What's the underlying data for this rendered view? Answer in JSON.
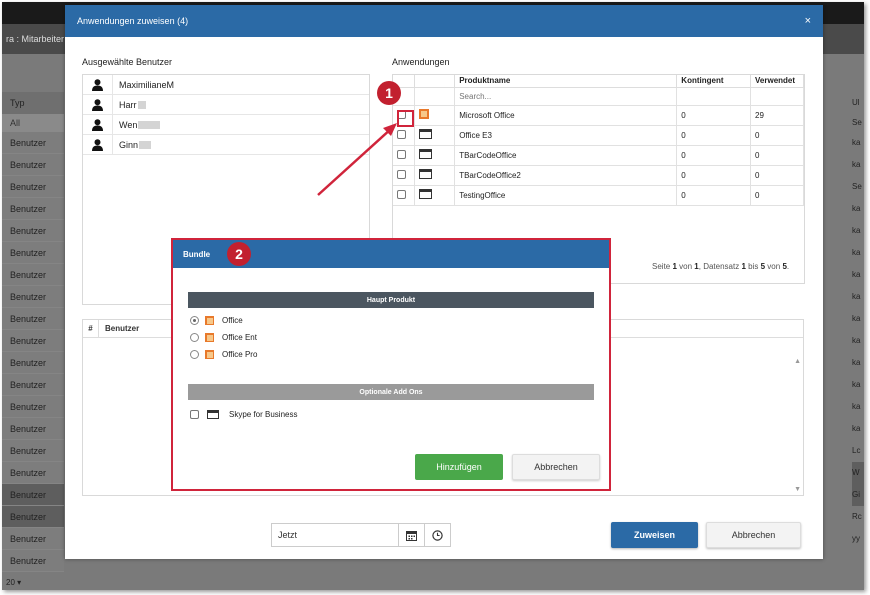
{
  "background": {
    "breadcrumb": "ra : Mitarbeiter (",
    "type_header": "Typ",
    "type_filter": "All",
    "rows": [
      "Benutzer",
      "Benutzer",
      "Benutzer",
      "Benutzer",
      "Benutzer",
      "Benutzer",
      "Benutzer",
      "Benutzer",
      "Benutzer",
      "Benutzer",
      "Benutzer",
      "Benutzer",
      "Benutzer",
      "Benutzer",
      "Benutzer",
      "Benutzer",
      "Benutzer",
      "Benutzer",
      "Benutzer",
      "Benutzer"
    ],
    "right_header": "Ul",
    "right_filter": "Se",
    "right_cells": [
      "ka",
      "ka",
      "Se",
      "ka",
      "ka",
      "ka",
      "ka",
      "ka",
      "ka",
      "ka",
      "ka",
      "ka",
      "ka",
      "ka",
      "Lc",
      "W",
      "Gi",
      "Rc",
      "yy"
    ],
    "page_size": "20"
  },
  "modal": {
    "title": "Anwendungen zuweisen (4)",
    "close": "×",
    "selected_users_title": "Ausgewählte Benutzer",
    "users": [
      "MaximilianeM",
      "Harr",
      "Wen",
      "Ginn"
    ],
    "applications_title": "Anwendungen",
    "apps_columns": {
      "name": "Produktname",
      "quota": "Kontingent",
      "used": "Verwendet"
    },
    "search_placeholder": "Search...",
    "apps": [
      {
        "name": "Microsoft Office",
        "quota": "0",
        "used": "29",
        "icon": "office-icon"
      },
      {
        "name": "Office E3",
        "quota": "0",
        "used": "0",
        "icon": "window-icon"
      },
      {
        "name": "TBarCodeOffice",
        "quota": "0",
        "used": "0",
        "icon": "window-icon"
      },
      {
        "name": "TBarCodeOffice2",
        "quota": "0",
        "used": "0",
        "icon": "window-icon"
      },
      {
        "name": "TestingOffice",
        "quota": "0",
        "used": "0",
        "icon": "window-icon"
      }
    ],
    "pager": {
      "prefix": "Seite",
      "page": "1",
      "of": "von",
      "total_pages": "1",
      "record": ", Datensatz",
      "from": "1",
      "to_word": "bis",
      "to": "5",
      "von2": "von",
      "total": "5",
      "suffix": "."
    },
    "assign_columns": {
      "hash": "#",
      "user": "Benutzer"
    },
    "date_value": "Jetzt",
    "assign_button": "Zuweisen",
    "cancel_button": "Abbrechen"
  },
  "bundle": {
    "title": "Bundle",
    "main_section": "Haupt Produkt",
    "products": [
      {
        "label": "Office",
        "selected": true
      },
      {
        "label": "Office Ent",
        "selected": false
      },
      {
        "label": "Office Pro",
        "selected": false
      }
    ],
    "addons_section": "Optionale Add Ons",
    "addons": [
      {
        "label": "Skype for Business",
        "checked": false
      }
    ],
    "add_button": "Hinzufügen",
    "cancel_button": "Abbrechen"
  },
  "annotations": {
    "badge1": "1",
    "badge2": "2",
    "color": "#d0243b"
  }
}
